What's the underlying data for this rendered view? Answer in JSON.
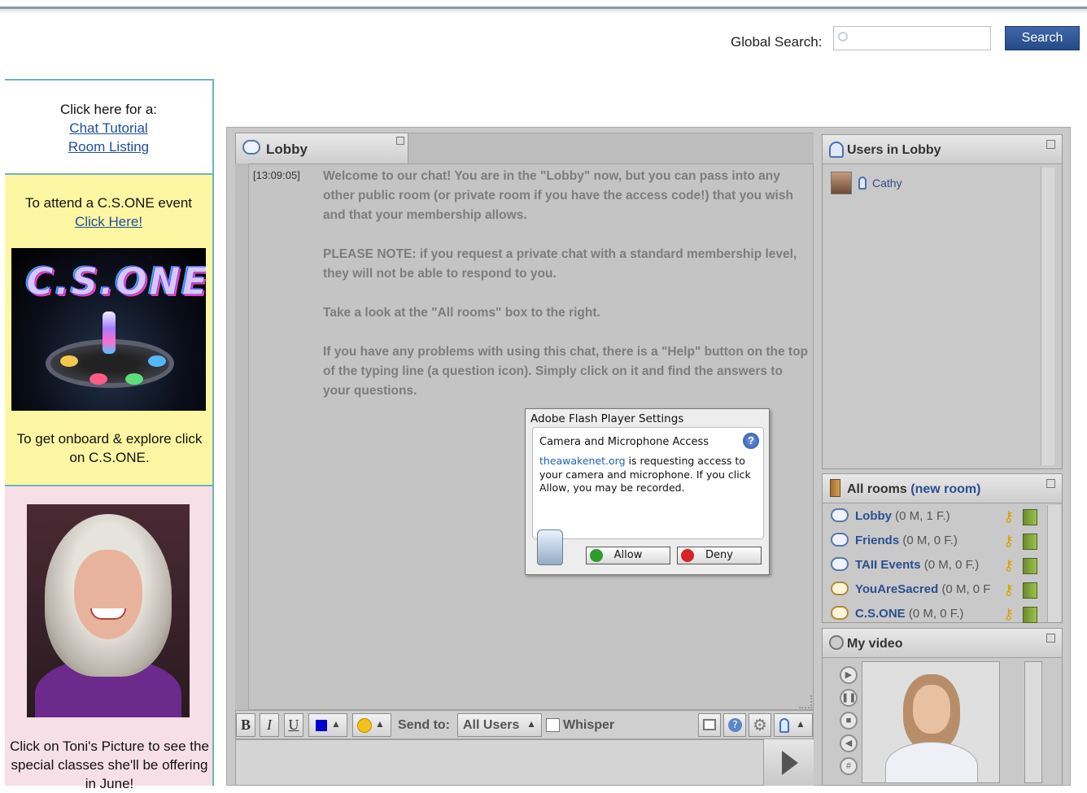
{
  "global_search": {
    "label": "Global Search:",
    "placeholder": "",
    "value": "",
    "button": "Search"
  },
  "sidebar": {
    "tutorial_box": {
      "intro": "Click here for a:",
      "link1": "Chat Tutorial",
      "link2": "Room Listing"
    },
    "event_box": {
      "text": "To attend a C.S.ONE event",
      "link": "Click Here!",
      "logo_text": "C.S.ONE",
      "caption": "To get onboard & explore click on C.S.ONE."
    },
    "toni_box": {
      "caption": "Click on Toni's Picture to see the special classes she'll be offering in June!"
    }
  },
  "chat": {
    "tab_label": "Lobby",
    "timestamp": "[13:09:05]",
    "messages": [
      "Welcome to our chat! You are in the \"Lobby\" now, but you can pass into any other public room (or private room if you have the access code!) that you wish and that your membership allows.",
      "PLEASE NOTE: if you request a private chat with a standard membership level, they will not be able to respond to you.",
      "Take a look at the \"All rooms\" box to the right.",
      "If you have any problems with using this chat, there is a \"Help\" button on the top of the typing line (a question icon). Simply click on it and find the answers to your questions."
    ],
    "toolbar": {
      "bold": "B",
      "italic": "I",
      "underline": "U",
      "send_to_label": "Send to:",
      "send_to_value": "All Users",
      "whisper": "Whisper",
      "text_color": "#0000cc"
    }
  },
  "users_panel": {
    "title": "Users in Lobby",
    "users": [
      {
        "name": "Cathy"
      }
    ]
  },
  "rooms_panel": {
    "title": "All rooms",
    "new_room": "(new room)",
    "rooms": [
      {
        "name": "Lobby",
        "count": "(0 M, 1 F.)"
      },
      {
        "name": "Friends",
        "count": "(0 M, 0 F.)"
      },
      {
        "name": "TAII Events",
        "count": "(0 M, 0 F.)"
      },
      {
        "name": "YouAreSacred",
        "count": "(0 M, 0 F"
      },
      {
        "name": "C.S.ONE",
        "count": "(0 M, 0 F.)"
      }
    ]
  },
  "video_panel": {
    "title": "My video"
  },
  "flash_dialog": {
    "title": "Adobe Flash Player Settings",
    "heading": "Camera and Microphone Access",
    "domain": "theawakenet.org",
    "message": " is requesting access to your camera and microphone. If you click Allow, you may be recorded.",
    "allow": "Allow",
    "deny": "Deny"
  }
}
